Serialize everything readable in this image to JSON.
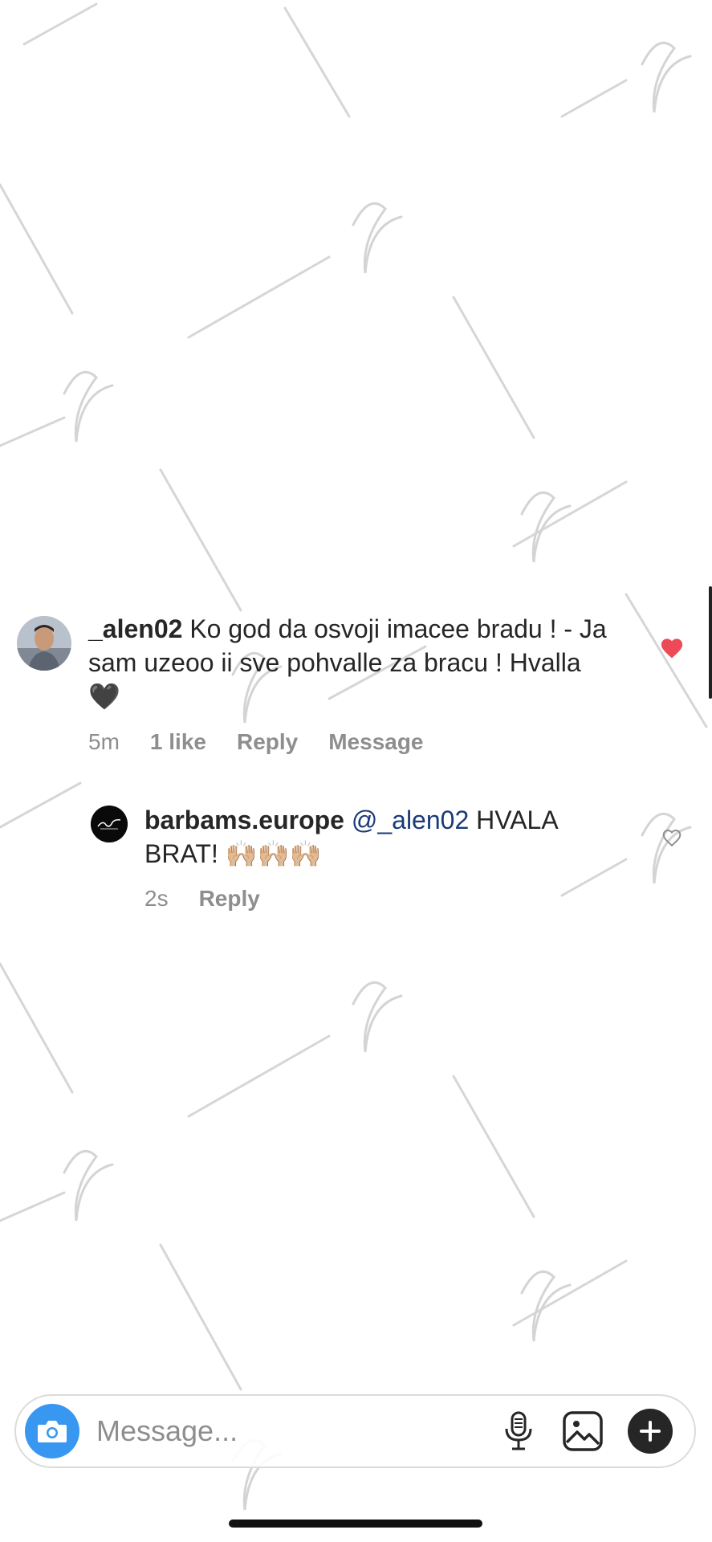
{
  "comments": [
    {
      "username": "_alen02",
      "text": "Ko god da osvoji imacee bradu ! - Ja sam uzeoo ii sve pohvalle za bracu ! Hvalla",
      "emoji": "🖤",
      "time": "5m",
      "likes": "1 like",
      "reply_label": "Reply",
      "message_label": "Message",
      "liked": true
    }
  ],
  "replies": [
    {
      "username": "barbams.europe",
      "mention": "@_alen02",
      "text": "HVALA BRAT!",
      "emoji": "🙌🏼🙌🏼🙌🏼",
      "time": "2s",
      "reply_label": "Reply",
      "liked": false
    }
  ],
  "composer": {
    "placeholder": "Message..."
  },
  "colors": {
    "accent": "#3897f0",
    "like": "#ed4956",
    "mention": "#1a3a78",
    "meta": "#8e8e8e"
  },
  "icons": [
    "camera-icon",
    "microphone-icon",
    "gallery-icon",
    "plus-icon",
    "heart-icon",
    "heart-outline-icon"
  ]
}
